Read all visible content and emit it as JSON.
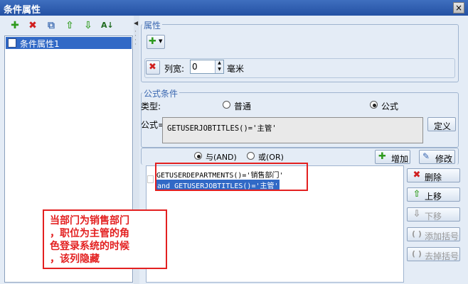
{
  "window": {
    "title": "条件属性",
    "close_glyph": "×"
  },
  "left_toolbar": {
    "icons": [
      "add-icon",
      "delete-icon",
      "copy-icon",
      "move-up-icon",
      "move-down-icon",
      "sort-icon"
    ]
  },
  "tree": {
    "items": [
      {
        "label": "条件属性1",
        "selected": true
      }
    ]
  },
  "property": {
    "legend": "属性",
    "column_width_label": "列宽:",
    "column_width_value": "0",
    "unit": "毫米"
  },
  "formula_condition": {
    "legend": "公式条件",
    "type_label": "类型:",
    "type_options": [
      {
        "label": "普通",
        "selected": false
      },
      {
        "label": "公式",
        "selected": true
      }
    ],
    "formula_label": "公式=",
    "formula_value": "GETUSERJOBTITLES()='主管'",
    "define_button": "定义"
  },
  "logic": {
    "and_label": "与(AND)",
    "or_label": "或(OR)",
    "selected": "and",
    "add_button": "增加",
    "edit_button": "修改"
  },
  "conditions": {
    "lines": [
      "GETUSERDEPARTMENTS()='销售部门'",
      "and GETUSERJOBTITLES()='主管'"
    ]
  },
  "side_buttons": {
    "delete": "删除",
    "move_up": "上移",
    "move_down": "下移",
    "add_bracket": "添加括号",
    "remove_bracket": "去掉括号"
  },
  "annotation": {
    "text": "当部门为销售部门\n，职位为主管的角\n色登录系统的时候\n，该列隐藏"
  },
  "colors": {
    "accent": "#3169c6",
    "annotation": "#e32020"
  }
}
